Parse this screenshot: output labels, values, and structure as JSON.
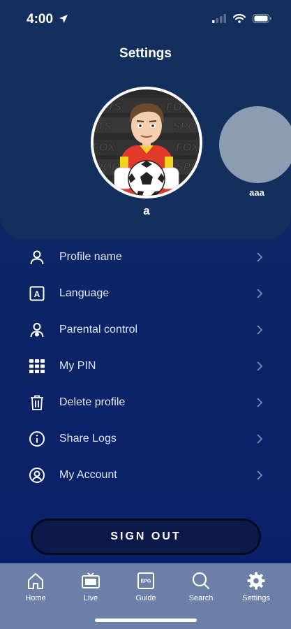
{
  "status_bar": {
    "time": "4:00"
  },
  "header": {
    "title": "Settings"
  },
  "profiles": [
    {
      "name": "a"
    },
    {
      "name": "aaa"
    }
  ],
  "avatar_art": {
    "logo_text": "FOX SPORTS"
  },
  "menu": {
    "items": [
      {
        "label": "Profile name",
        "icon": "person-icon"
      },
      {
        "label": "Language",
        "icon": "language-icon"
      },
      {
        "label": "Parental control",
        "icon": "parental-control-icon"
      },
      {
        "label": "My PIN",
        "icon": "pin-grid-icon"
      },
      {
        "label": "Delete profile",
        "icon": "trash-icon"
      },
      {
        "label": "Share Logs",
        "icon": "info-icon"
      },
      {
        "label": "My Account",
        "icon": "account-circle-icon"
      }
    ]
  },
  "sign_out": {
    "label": "SIGN OUT"
  },
  "tabbar": {
    "tabs": [
      {
        "label": "Home",
        "icon": "home-icon"
      },
      {
        "label": "Live",
        "icon": "tv-icon"
      },
      {
        "label": "Guide",
        "icon": "guide-icon",
        "icon_text": "EPG"
      },
      {
        "label": "Search",
        "icon": "search-icon"
      },
      {
        "label": "Settings",
        "icon": "gear-icon",
        "selected": true
      }
    ]
  },
  "colors": {
    "background": "#0c2466",
    "panel": "#132f5d",
    "tabbar": "#6b7fa7",
    "secondary_avatar": "#8d9db1"
  }
}
